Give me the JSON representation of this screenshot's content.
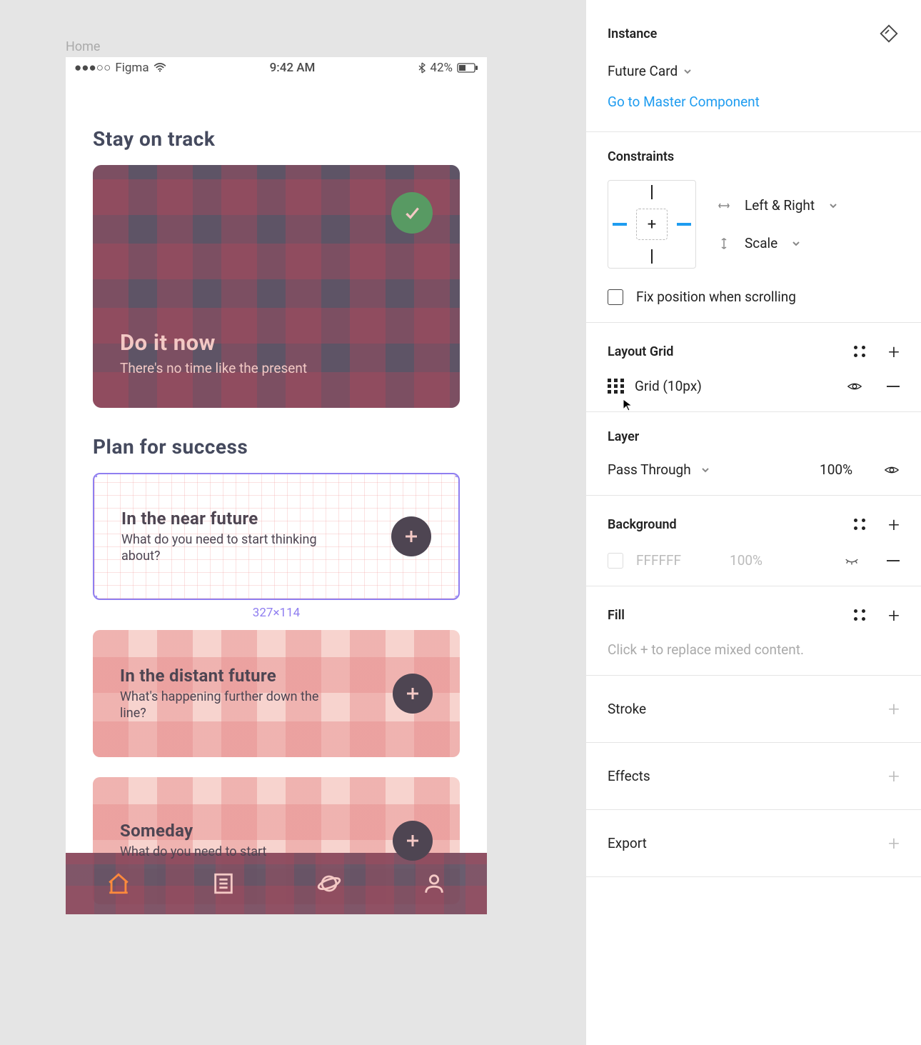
{
  "canvas": {
    "frame_label": "Home",
    "status": {
      "carrier": "Figma",
      "time": "9:42 AM",
      "battery": "42%"
    },
    "section1_title": "Stay on track",
    "big_card": {
      "title": "Do it now",
      "subtitle": "There's no time like the present"
    },
    "section2_title": "Plan for success",
    "cards": [
      {
        "title": "In the near future",
        "subtitle": "What do you need to start thinking about?"
      },
      {
        "title": "In the distant future",
        "subtitle": "What's happening further down the line?"
      },
      {
        "title": "Someday",
        "subtitle": "What do you need to start"
      }
    ],
    "selection_size": "327×114"
  },
  "panel": {
    "instance": {
      "header": "Instance",
      "name": "Future Card",
      "link": "Go to Master Component"
    },
    "constraints": {
      "header": "Constraints",
      "h": "Left & Right",
      "v": "Scale",
      "fix": "Fix position when scrolling"
    },
    "layout_grid": {
      "header": "Layout Grid",
      "item": "Grid (10px)"
    },
    "layer": {
      "header": "Layer",
      "blend": "Pass Through",
      "opacity": "100%"
    },
    "background": {
      "header": "Background",
      "color": "FFFFFF",
      "opacity": "100%"
    },
    "fill": {
      "header": "Fill",
      "placeholder": "Click + to replace mixed content."
    },
    "stroke": "Stroke",
    "effects": "Effects",
    "export": "Export"
  }
}
